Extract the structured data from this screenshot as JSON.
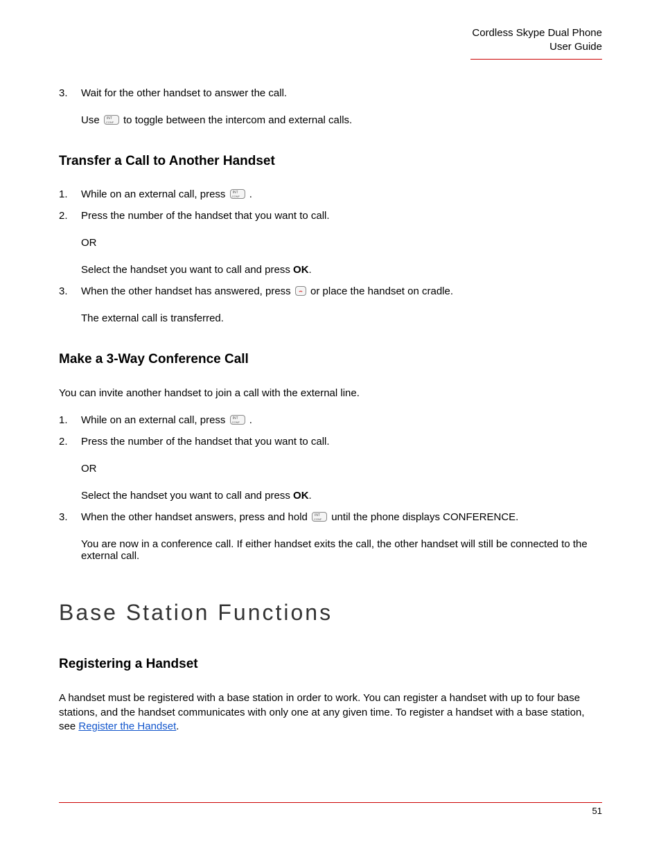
{
  "header": {
    "line1": "Cordless Skype Dual Phone",
    "line2": "User Guide"
  },
  "topList": {
    "num": "3.",
    "line1": "Wait for the other handset to answer the call.",
    "line2a": "Use ",
    "line2b": " to toggle between the intercom and external calls."
  },
  "transfer": {
    "heading": "Transfer a Call to Another Handset",
    "item1": {
      "num": "1.",
      "pre": "While on an external call, press ",
      "post": " ."
    },
    "item2": {
      "num": "2.",
      "text": "Press the number of the handset that you want to call.",
      "or": "OR",
      "selectPre": "Select the handset you want to call and press ",
      "ok": "OK",
      "selectPost": "."
    },
    "item3": {
      "num": "3.",
      "pre": "When the other handset has answered, press ",
      "post": "  or place the handset on cradle.",
      "sub": "The external call is transferred."
    }
  },
  "conf": {
    "heading": "Make a 3-Way Conference Call",
    "intro": "You can invite another handset to join a call with the external line.",
    "item1": {
      "num": "1.",
      "pre": "While on an external call, press ",
      "post": " ."
    },
    "item2": {
      "num": "2.",
      "text": "Press the number of the handset that you want to call.",
      "or": "OR",
      "selectPre": "Select the handset you want to call and press ",
      "ok": "OK",
      "selectPost": "."
    },
    "item3": {
      "num": "3.",
      "pre": "When the other handset answers, press and hold ",
      "post": "  until the phone displays CONFERENCE.",
      "sub": "You are now in a conference call. If either handset exits the call, the other handset will still be connected to the external call."
    }
  },
  "base": {
    "title": "Base Station Functions",
    "heading": "Registering a Handset",
    "para1": "A handset must be registered with a base station in order to work. You can register a handset with up to four base stations, and the handset communicates with only one at any given time. To register a handset with a base station, see ",
    "link": "Register the Handset",
    "para2": "."
  },
  "pageNumber": "51"
}
